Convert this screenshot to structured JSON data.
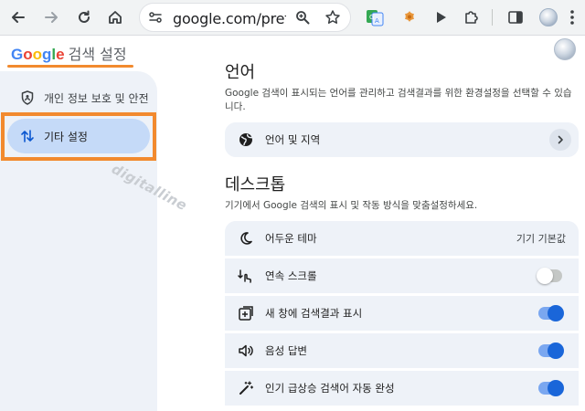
{
  "browser": {
    "url": "google.com/prefe",
    "icons": [
      "back-arrow-icon",
      "forward-arrow-icon",
      "reload-icon",
      "home-icon",
      "site-info-icon",
      "zoom-icon",
      "bookmark-star-icon",
      "translate-icon",
      "extension-leaf-icon",
      "play-icon",
      "puzzle-extensions-icon",
      "side-panel-icon",
      "profile-icon",
      "more-vert-icon"
    ]
  },
  "header": {
    "logo": {
      "G": "G",
      "o1": "o",
      "o2": "o",
      "g": "g",
      "l": "l",
      "e": "e"
    },
    "title": "검색 설정"
  },
  "sidebar": {
    "items": [
      {
        "label": "개인 정보 보호 및 안전",
        "icon": "shield-icon"
      },
      {
        "label": "기타 설정",
        "icon": "sort-arrows-icon",
        "active": true
      }
    ]
  },
  "watermark": "digitalline",
  "language": {
    "title": "언어",
    "description": "Google 검색이 표시되는 언어를 관리하고 검색결과를 위한 환경설정을 선택할 수 있습니다.",
    "row_label": "언어 및 지역"
  },
  "desktop": {
    "title": "데스크톱",
    "description": "기기에서 Google 검색의 표시 및 작동 방식을 맞춤설정하세요.",
    "rows": [
      {
        "label": "어두운 테마",
        "value": "기기 기본값",
        "icon": "moon-icon"
      },
      {
        "label": "연속 스크롤",
        "toggle": false,
        "icon": "continuous-scroll-icon"
      },
      {
        "label": "새 창에 검색결과 표시",
        "toggle": true,
        "icon": "open-new-window-icon"
      },
      {
        "label": "음성 답변",
        "toggle": true,
        "icon": "speaker-icon"
      },
      {
        "label": "인기 급상승 검색어 자동 완성",
        "toggle": true,
        "icon": "magic-wand-icon"
      }
    ]
  },
  "colors": {
    "accent": "#f28a2e",
    "toggle_on": "#1a66d9",
    "sidebar_bg": "#eef2f8",
    "active_item": "#c5daf8"
  }
}
